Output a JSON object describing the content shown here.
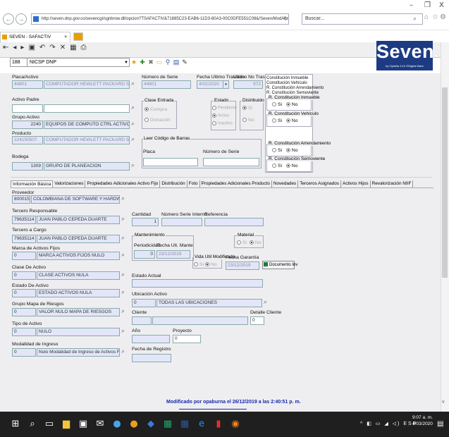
{
  "window": {
    "minimize": "–",
    "maximize": "❐",
    "close": "X"
  },
  "browser": {
    "url": "http://seven.dnp.gov.co/sevencgi/sgnbrow.dll/opcion?TSAFACTIV&71885C23-EAB6-11D3-80A3-00C0DFE551C08&/Seven/ModAdmin/Af_Actf/CAF",
    "search_placeholder": "Buscar...",
    "tab_label": "SEVEN - SAFACTIV",
    "tab_close": "×"
  },
  "app": {
    "logo_text": "Seven",
    "logo_suffix": "-ERP",
    "logo_sub": "by Ophelia 14.0   ©Digital Ware",
    "company_code": "188",
    "company_name": "NICSP DNP"
  },
  "form": {
    "placa": {
      "label": "Placa/Activo",
      "code": "44801",
      "desc": "COMPUTADOR HEWLETT PACKARD SFF"
    },
    "numero_serie": {
      "label": "Número de Serie",
      "value": "44801"
    },
    "fecha_ult_traslado": {
      "label": "Fecha Ultimo Traslado",
      "value": "4/02/2020"
    },
    "ult_no_traslado": {
      "label": "Ultimo No Traslado",
      "value": "972"
    },
    "activo_padre": {
      "label": "Activo Padre"
    },
    "clase_entrada": {
      "label": "Clase Entrada",
      "opt1": "Compra",
      "opt2": "Donación"
    },
    "estado": {
      "label": "Estado",
      "opt1": "Pendiente",
      "opt2": "Activo",
      "opt3": "Inactivo"
    },
    "distribuido": {
      "label": "Distribuido",
      "opt1": "Si",
      "opt2": "No"
    },
    "grupo_activo": {
      "label": "Grupo Activo",
      "code": "2240",
      "desc": "EQUIPOS DE COMPUTO CTRL ACTIVO"
    },
    "producto": {
      "label": "Producto",
      "code": "224150507",
      "desc": "COMPUTADOR HEWLETT PACKARD SFF"
    },
    "leer_codigo": "Leer Código de Barras",
    "placa2": {
      "label": "Placa"
    },
    "numero_serie2": {
      "label": "Número de Serie"
    },
    "bodega": {
      "label": "Bodega",
      "code": "1309",
      "desc": "GRUPO DE PLANEACION"
    },
    "constituciones": {
      "c1": "Constitución Inmueble",
      "c2": "Constitución Vehículo",
      "c3": "R. Constitución Arrendamiento",
      "c4": "R. Constitución Semoviente",
      "g1": "R. Constitución Inmueble",
      "g2": "R. Constitución Vehículo",
      "g3": "R. Constitución Arrendamiento",
      "g4": "R. Constitución Semoviente",
      "si": "Si",
      "no": "No"
    }
  },
  "tabs": [
    "Información Básica",
    "Valorizaciones",
    "Propiedades Adicionales Activo Fijo",
    "Distribución",
    "Foto",
    "Propiedades Adicionales Producto",
    "Novedades",
    "Terceros Asignados",
    "Activos Hijos",
    "Revalorización NIIF"
  ],
  "basic": {
    "proveedor": {
      "label": "Proveedor",
      "code": "800015503",
      "desc": "COLOMBIANA DE SOFTWARE Y HARDWARE CC"
    },
    "tercero_resp": {
      "label": "Tercero Responsable",
      "code": "79635114",
      "desc": "JUAN PABLO CEPEDA DUARTE"
    },
    "tercero_cargo": {
      "label": "Tercero a Cargo",
      "code": "79635114",
      "desc": "JUAN PABLO CEPEDA DUARTE"
    },
    "marca": {
      "label": "Marca de Activos Fijos",
      "code": "0",
      "desc": "MARCA ACTIVOS FIJOS NULO"
    },
    "clase": {
      "label": "Clase De Activo",
      "code": "0",
      "desc": "CLASE ACTIVOS NULA"
    },
    "estado_activo": {
      "label": "Estado De Activo",
      "code": "0",
      "desc": "ESTADO ACTIVOS NULA"
    },
    "grupo_riesgos": {
      "label": "Grupo Mapa de Riesgos",
      "code": "0",
      "desc": "VALOR NULO MAPA DE RIESGOS"
    },
    "tipo": {
      "label": "Tipo de Activo",
      "code": "0",
      "desc": "NULO"
    },
    "modalidad": {
      "label": "Modalidad de Ingreso",
      "code": "0",
      "desc": "Nulo Modalidad de Ingreso de Activos Fijos"
    },
    "cantidad": {
      "label": "Cantidad",
      "value": "1"
    },
    "num_serie_int": {
      "label": "Número Serie Interno"
    },
    "referencia": {
      "label": "Referencia"
    },
    "mantenimiento": {
      "label": "Mantenimiento",
      "periodicidad": "Periodicidad",
      "periodicidad_val": "0",
      "fecha_label": "Fecha Ult. Mante",
      "fecha_val": "23/12/2019"
    },
    "material": {
      "label": "Material",
      "si": "Si",
      "no": "No"
    },
    "vida_util": {
      "label": "Vida Util Modificada",
      "si": "Si",
      "no": "No"
    },
    "fecha_garantia": {
      "label": "Fecha Garantía",
      "value": "23/12/2019"
    },
    "documento_btn": "Documento Inv",
    "estado_actual": {
      "label": "Estado Actual"
    },
    "ubicacion": {
      "label": "Ubicación Activo",
      "code": "0",
      "desc": "TODAS LAS UBICACIONES"
    },
    "cliente": {
      "label": "Cliente"
    },
    "detalle_cliente": {
      "label": "Detalle Cliente",
      "value": "0"
    },
    "anio": {
      "label": "Año"
    },
    "proyecto": {
      "label": "Proyecto",
      "value": "0"
    },
    "fecha_registro": {
      "label": "Fecha de Registro"
    }
  },
  "status_text": "Modificado por opaburna el 26/12/2019 a las 2:40:51 p. m.",
  "taskbar": {
    "time": "9:07 a. m.",
    "date": "4/03/2020",
    "lang": "ESP"
  }
}
